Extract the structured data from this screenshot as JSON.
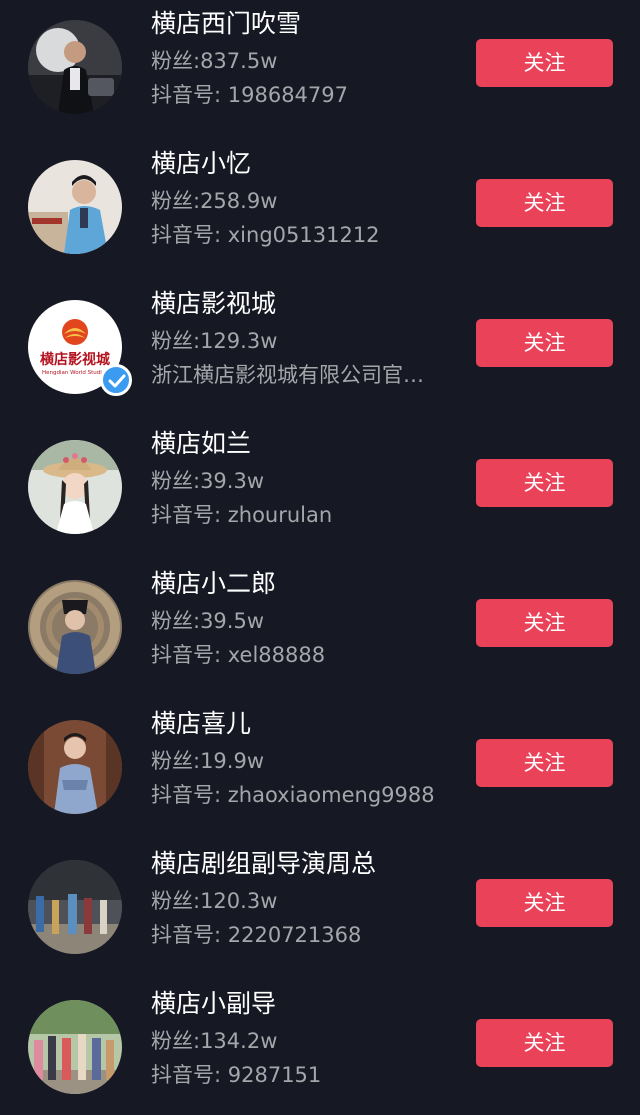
{
  "colors": {
    "background": "#161823",
    "follow_button": "#ea4258",
    "secondary_text": "#a5a6ab",
    "verified_badge": "#3a9bf0"
  },
  "users": [
    {
      "name": "横店西门吹雪",
      "fans": "粉丝:837.5w",
      "sub": "抖音号: 198684797",
      "follow_label": "关注",
      "verified": false
    },
    {
      "name": "横店小忆",
      "fans": "粉丝:258.9w",
      "sub": "抖音号: xing05131212",
      "follow_label": "关注",
      "verified": false
    },
    {
      "name": "横店影视城",
      "fans": "粉丝:129.3w",
      "sub": "浙江横店影视城有限公司官…",
      "follow_label": "关注",
      "verified": true,
      "logo_text": "横店影视城",
      "logo_subtext": "Hengdian World Studios"
    },
    {
      "name": "横店如兰",
      "fans": "粉丝:39.3w",
      "sub": "抖音号: zhourulan",
      "follow_label": "关注",
      "verified": false
    },
    {
      "name": "横店小二郎",
      "fans": "粉丝:39.5w",
      "sub": "抖音号: xel88888",
      "follow_label": "关注",
      "verified": false
    },
    {
      "name": "横店喜儿",
      "fans": "粉丝:19.9w",
      "sub": "抖音号: zhaoxiaomeng9988",
      "follow_label": "关注",
      "verified": false
    },
    {
      "name": "横店剧组副导演周总",
      "fans": "粉丝:120.3w",
      "sub": "抖音号: 2220721368",
      "follow_label": "关注",
      "verified": false
    },
    {
      "name": "横店小副导",
      "fans": "粉丝:134.2w",
      "sub": "抖音号: 9287151",
      "follow_label": "关注",
      "verified": false
    }
  ]
}
